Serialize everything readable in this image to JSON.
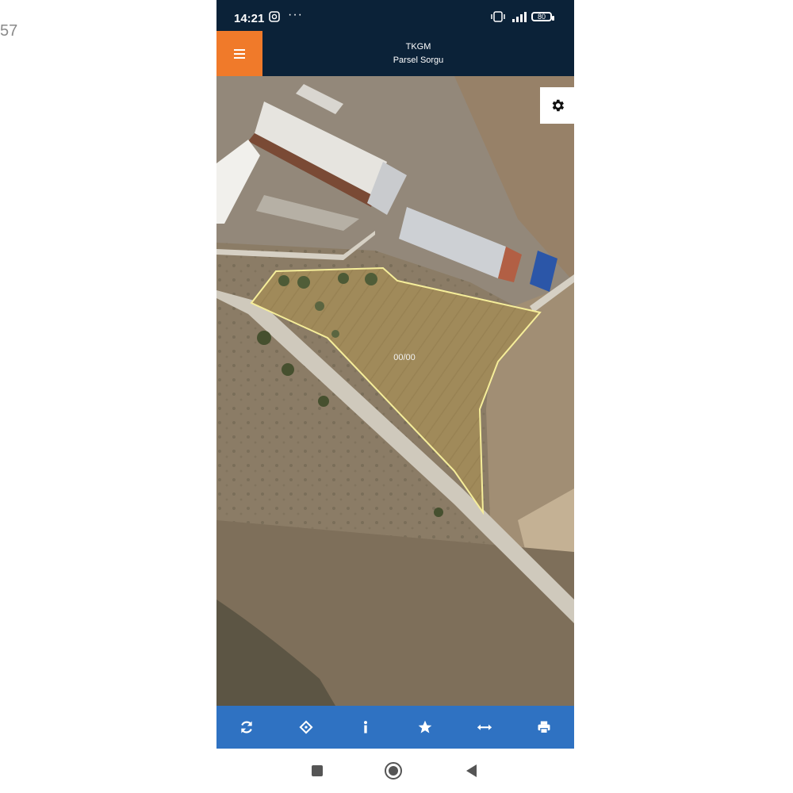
{
  "edge_text": "57",
  "status_bar": {
    "time": "14:21",
    "more": "···",
    "battery": "80"
  },
  "header": {
    "title": "TKGM",
    "subtitle": "Parsel Sorgu",
    "menu_icon": "hamburger-menu-icon"
  },
  "map": {
    "parcel_label": "00/00",
    "parcel_outline_color": "#f6ee9a",
    "settings_icon": "gear-icon"
  },
  "toolbar": {
    "background": "#2f72c2",
    "icons": [
      "refresh-icon",
      "locate-icon",
      "info-icon",
      "star-icon",
      "measure-icon",
      "print-icon"
    ]
  },
  "nav_bar": {
    "icons": [
      "recent-apps-icon",
      "home-icon",
      "back-icon"
    ]
  }
}
